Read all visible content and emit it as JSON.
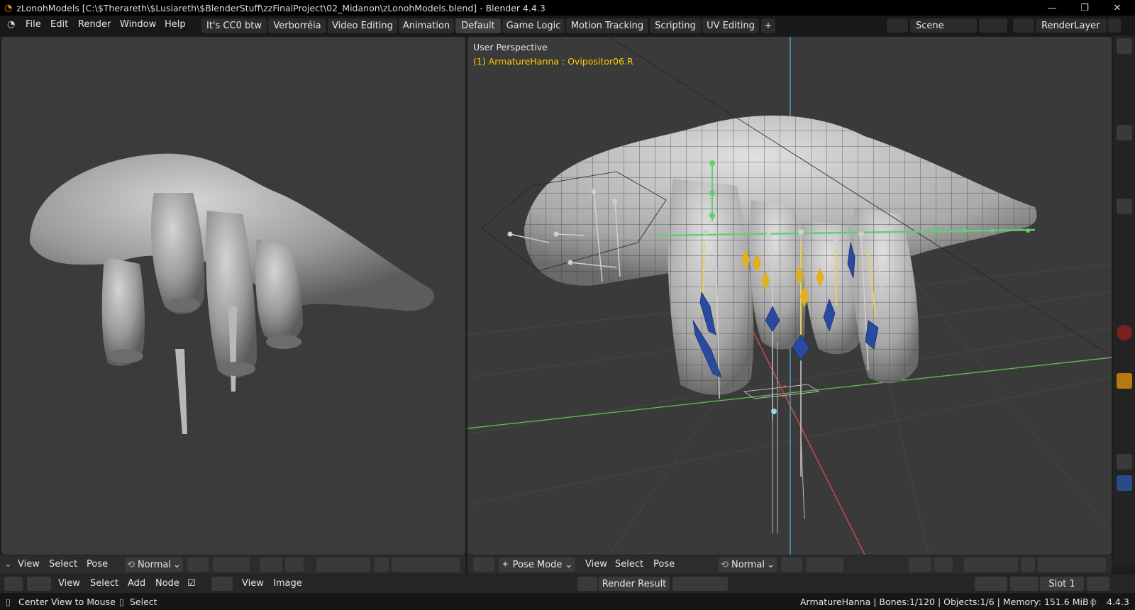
{
  "window": {
    "title": "zLonohModels [C:\\$Therareth\\$Lusiareth\\$BlenderStuff\\zzFinalProject\\02_Midanon\\zLonohModels.blend] - Blender 4.4.3",
    "minimize": "—",
    "maximize": "❐",
    "close": "✕"
  },
  "menus": [
    "File",
    "Edit",
    "Render",
    "Window",
    "Help"
  ],
  "workspaces": [
    "It's CC0 btw",
    "Verborréia",
    "Video Editing",
    "Animation",
    "Default",
    "Game Logic",
    "Motion Tracking",
    "Scripting",
    "UV Editing"
  ],
  "active_workspace": "Default",
  "add_workspace": "+",
  "scene": {
    "label": "Scene"
  },
  "view_layer": {
    "label": "RenderLayer"
  },
  "viewport_left": {
    "header": {
      "items": [
        "View",
        "Select",
        "Pose"
      ],
      "orientation": "Normal"
    }
  },
  "viewport_right": {
    "overlay_title": "User Perspective",
    "overlay_subtitle": "(1) ArmatureHanna : Ovipositor06.R",
    "header": {
      "mode": "Pose Mode",
      "items": [
        "View",
        "Select",
        "Pose"
      ],
      "orientation": "Normal"
    }
  },
  "image_editor": {
    "items": [
      "View",
      "Select",
      "Add",
      "Node"
    ],
    "items2": [
      "View",
      "Image"
    ],
    "image_name": "Render Result",
    "slot": "Slot 1"
  },
  "status": {
    "left_hint_1": "Center View to Mouse",
    "left_hint_2": "Select",
    "info": "ArmatureHanna | Bones:1/120 | Objects:1/6 | Memory: 151.6 MiB | ",
    "version": "4.4.3"
  },
  "colors": {
    "accent": "#ffcc00",
    "axis_x": "#e05050",
    "axis_y": "#60c050",
    "axis_z": "#50a8d0",
    "active_tab": "#3d3d3d"
  }
}
